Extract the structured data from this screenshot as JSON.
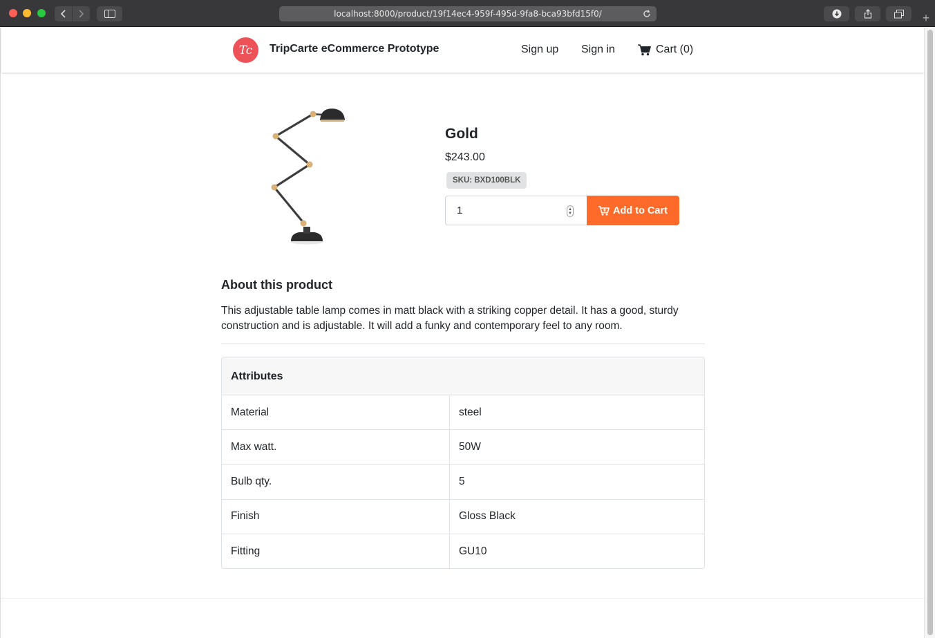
{
  "browser": {
    "url": "localhost:8000/product/19f14ec4-959f-495d-9fa8-bca93bfd15f0/"
  },
  "navbar": {
    "logo_text": "Tc",
    "brand": "TripCarte eCommerce Prototype",
    "signup": "Sign up",
    "signin": "Sign in",
    "cart": "Cart (0)"
  },
  "product": {
    "title": "Gold",
    "price": "$243.00",
    "sku": "SKU: BXD100BLK",
    "quantity": "1",
    "add_to_cart": "Add to Cart",
    "image_icon": "table-lamp"
  },
  "about": {
    "heading": "About this product",
    "text": "This adjustable table lamp comes in matt black with a striking copper detail. It has a good, sturdy construction and is adjustable. It will add a funky and contemporary feel to any room."
  },
  "attributes": {
    "heading": "Attributes",
    "rows": [
      {
        "key": "Material",
        "value": "steel"
      },
      {
        "key": "Max watt.",
        "value": "50W"
      },
      {
        "key": "Bulb qty.",
        "value": "5"
      },
      {
        "key": "Finish",
        "value": "Gloss Black"
      },
      {
        "key": "Fitting",
        "value": "GU10"
      }
    ]
  },
  "colors": {
    "accent": "#fd6a2a",
    "logo": "#ec5257"
  }
}
